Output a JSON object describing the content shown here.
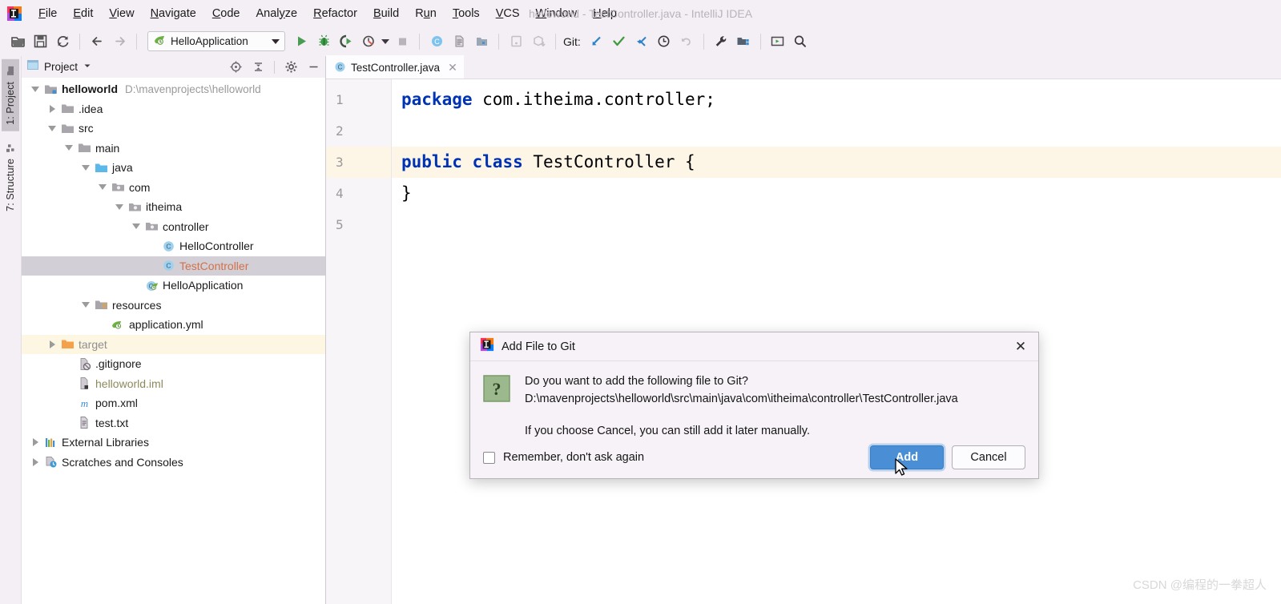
{
  "window": {
    "title": "helloworld - TestController.java - IntelliJ IDEA",
    "logo_icon": "intellij-idea-logo"
  },
  "menubar": {
    "items": [
      {
        "label": "File",
        "mnemonic": "F"
      },
      {
        "label": "Edit",
        "mnemonic": "E"
      },
      {
        "label": "View",
        "mnemonic": "V"
      },
      {
        "label": "Navigate",
        "mnemonic": "N"
      },
      {
        "label": "Code",
        "mnemonic": "C"
      },
      {
        "label": "Analyze",
        "mnemonic": "z"
      },
      {
        "label": "Refactor",
        "mnemonic": "R"
      },
      {
        "label": "Build",
        "mnemonic": "B"
      },
      {
        "label": "Run",
        "mnemonic": "u"
      },
      {
        "label": "Tools",
        "mnemonic": "T"
      },
      {
        "label": "VCS",
        "mnemonic": "V"
      },
      {
        "label": "Window",
        "mnemonic": "W"
      },
      {
        "label": "Help",
        "mnemonic": "H"
      }
    ]
  },
  "toolbar": {
    "open_icon": "open-folder-icon",
    "save_icon": "save-disk-icon",
    "sync_icon": "refresh-sync-icon",
    "back_icon": "arrow-left-icon",
    "forward_icon": "arrow-right-icon",
    "run_config_name": "HelloApplication",
    "run_config_icon": "spring-boot-icon",
    "run_icon": "run-play-icon",
    "debug_icon": "debug-bug-icon",
    "run_coverage_icon": "run-with-coverage-icon",
    "profile_icon": "profiler-icon",
    "stop_icon": "stop-square-icon",
    "compile_icon": "compile-class-icon",
    "doc_icon": "document-icon",
    "folder_blue_icon": "project-structure-icon",
    "device_icon": "device-manager-icon",
    "sdk_icon": "sdk-download-icon",
    "git_label": "Git:",
    "git_update_icon": "git-update-arrow-icon",
    "git_commit_icon": "git-commit-check-icon",
    "git_push_icon": "git-push-icon",
    "git_history_icon": "git-history-clock-icon",
    "git_rollback_icon": "git-rollback-icon",
    "settings_icon": "wrench-settings-icon",
    "project_structure_icon": "project-structure-folder-icon",
    "terminal_icon": "terminal-window-icon",
    "search_icon": "search-magnifier-icon"
  },
  "left_tool_strip": {
    "tabs": [
      {
        "label": "1: Project",
        "num": "1",
        "rest": ": Project",
        "icon": "project-folder-icon",
        "active": true
      },
      {
        "label": "7: Structure",
        "num": "7",
        "rest": ": Structure",
        "icon": "structure-blocks-icon",
        "active": false
      }
    ]
  },
  "project_panel": {
    "title": "Project",
    "title_icon": "project-view-icon",
    "dropdown_icon": "chevron-down-icon",
    "locate_icon": "scroll-from-source-icon",
    "collapse_icon": "collapse-all-icon",
    "settings_icon": "gear-icon",
    "hide_icon": "minimize-icon",
    "tree": [
      {
        "label": "helloworld",
        "path": "D:\\mavenprojects\\helloworld",
        "indent": 0,
        "twist": "down",
        "icon": "module-folder-icon",
        "style": "bold"
      },
      {
        "label": ".idea",
        "indent": 1,
        "twist": "right",
        "icon": "folder-icon",
        "style": "normal"
      },
      {
        "label": "src",
        "indent": 1,
        "twist": "down",
        "icon": "folder-icon",
        "style": "normal"
      },
      {
        "label": "main",
        "indent": 2,
        "twist": "down",
        "icon": "folder-icon",
        "style": "normal"
      },
      {
        "label": "java",
        "indent": 3,
        "twist": "down",
        "icon": "source-root-folder-icon",
        "style": "normal"
      },
      {
        "label": "com",
        "indent": 4,
        "twist": "down",
        "icon": "package-icon",
        "style": "normal"
      },
      {
        "label": "itheima",
        "indent": 5,
        "twist": "down",
        "icon": "package-icon",
        "style": "normal"
      },
      {
        "label": "controller",
        "indent": 6,
        "twist": "down",
        "icon": "package-icon",
        "style": "normal"
      },
      {
        "label": "HelloController",
        "indent": 7,
        "twist": "none",
        "icon": "java-class-icon",
        "style": "normal"
      },
      {
        "label": "TestController",
        "indent": 7,
        "twist": "none",
        "icon": "java-class-icon",
        "style": "orange",
        "selected": true
      },
      {
        "label": "HelloApplication",
        "indent": 6,
        "twist": "none",
        "icon": "spring-boot-class-icon",
        "style": "normal"
      },
      {
        "label": "resources",
        "indent": 3,
        "twist": "down",
        "icon": "resources-folder-icon",
        "style": "normal"
      },
      {
        "label": "application.yml",
        "indent": 4,
        "twist": "none",
        "icon": "spring-yaml-icon",
        "style": "normal"
      },
      {
        "label": "target",
        "indent": 1,
        "twist": "right",
        "icon": "excluded-folder-icon",
        "style": "grey-it",
        "highlight": true
      },
      {
        "label": ".gitignore",
        "indent": 2,
        "twist": "none",
        "icon": "gitignore-file-icon",
        "style": "normal"
      },
      {
        "label": "helloworld.iml",
        "indent": 2,
        "twist": "none",
        "icon": "iml-file-icon",
        "style": "olive"
      },
      {
        "label": "pom.xml",
        "indent": 2,
        "twist": "none",
        "icon": "maven-pom-icon",
        "style": "normal"
      },
      {
        "label": "test.txt",
        "indent": 2,
        "twist": "none",
        "icon": "text-file-icon",
        "style": "normal"
      },
      {
        "label": "External Libraries",
        "indent": 0,
        "twist": "right",
        "icon": "libraries-icon",
        "style": "normal"
      },
      {
        "label": "Scratches and Consoles",
        "indent": 0,
        "twist": "right",
        "icon": "scratches-icon",
        "style": "normal"
      }
    ]
  },
  "editor": {
    "tab": {
      "label": "TestController.java",
      "icon": "java-class-icon",
      "close_icon": "close-icon"
    },
    "lines": [
      {
        "number": "1",
        "segments": [
          {
            "text": "package",
            "type": "keyword"
          },
          {
            "text": " com.itheima.controller;",
            "type": "plain"
          }
        ],
        "current": false
      },
      {
        "number": "2",
        "segments": [],
        "current": false
      },
      {
        "number": "3",
        "segments": [
          {
            "text": "public",
            "type": "keyword"
          },
          {
            "text": " ",
            "type": "plain"
          },
          {
            "text": "class",
            "type": "keyword"
          },
          {
            "text": " TestController {",
            "type": "plain"
          }
        ],
        "current": true
      },
      {
        "number": "4",
        "segments": [
          {
            "text": "}",
            "type": "plain"
          }
        ],
        "current": false
      },
      {
        "number": "5",
        "segments": [],
        "current": false
      }
    ]
  },
  "dialog": {
    "title": "Add File to Git",
    "title_icon": "intellij-idea-logo",
    "close_icon": "close-icon",
    "question_icon": "question-mark-icon",
    "message_line1": "Do you want to add the following file to Git?",
    "message_line2": "D:\\mavenprojects\\helloworld\\src\\main\\java\\com\\itheima\\controller\\TestController.java",
    "message_line3": "If you choose Cancel, you can still add it later manually.",
    "checkbox_label": "Remember, don't ask again",
    "checkbox_checked": false,
    "add_button": "Add",
    "cancel_button": "Cancel"
  },
  "watermark": "CSDN @编程的一拳超人",
  "colors": {
    "chrome": "#f4eff4",
    "panel_bg": "#ffffff",
    "accent_blue": "#4a8fd6",
    "selection": "#d3cfd6",
    "highlight_row": "#fdf6e3",
    "keyword": "#0033b3",
    "orange_text": "#d2714a",
    "current_line": "#fdf6e7"
  }
}
